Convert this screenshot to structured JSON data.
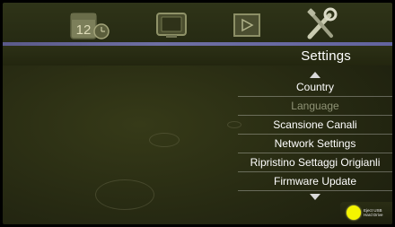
{
  "tabs": [
    {
      "icon": "calendar-clock-icon",
      "label": ""
    },
    {
      "icon": "tv-icon",
      "label": ""
    },
    {
      "icon": "media-player-icon",
      "label": ""
    },
    {
      "icon": "tools-icon",
      "label": ""
    }
  ],
  "section_title": "Settings",
  "menu": {
    "items": [
      {
        "label": "Country",
        "state": "normal"
      },
      {
        "label": "Language",
        "state": "selected"
      },
      {
        "label": "Scansione Canali",
        "state": "normal"
      },
      {
        "label": "Network Settings",
        "state": "normal"
      },
      {
        "label": "Ripristino Settaggi Origianli",
        "state": "normal"
      },
      {
        "label": "Firmware Update",
        "state": "normal"
      }
    ]
  },
  "eject": {
    "line1": "Eject USB",
    "line2": "Hard Drive"
  },
  "colors": {
    "background": "#262912",
    "accent_line": "#6e6fa3",
    "text": "#ffffff",
    "selected_text": "#8f9376",
    "eject_dot": "#f4f400"
  }
}
